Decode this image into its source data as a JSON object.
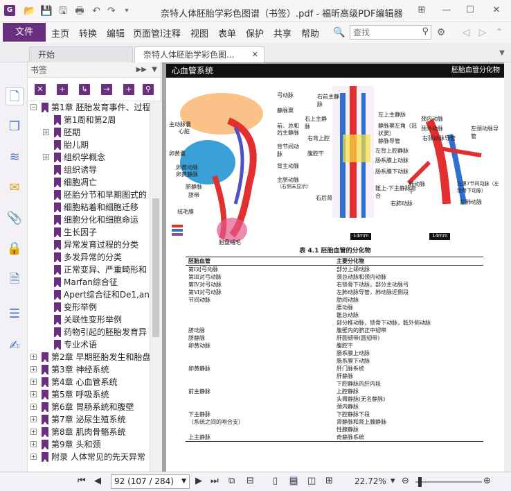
{
  "window": {
    "title": "奈特人体胚胎学彩色图谱（书签）.pdf - 福昕高级PDF编辑器",
    "app_icon": "G"
  },
  "menu": {
    "file": "文件",
    "items": [
      "主页",
      "转换",
      "编辑",
      "页面管理",
      "注释",
      "视图",
      "表单",
      "保护",
      "共享",
      "帮助"
    ],
    "search_placeholder": "查找"
  },
  "tabs": [
    {
      "label": "开始"
    },
    {
      "label": "奈特人体胚胎学彩色图..."
    }
  ],
  "bookmark_panel": {
    "title": "书签",
    "items": [
      {
        "label": "第1章 胚胎发育事件、过程",
        "level": 0,
        "exp": "−"
      },
      {
        "label": "第1周和第2周",
        "level": 1,
        "exp": ""
      },
      {
        "label": "胚期",
        "level": 1,
        "exp": "+"
      },
      {
        "label": "胎儿期",
        "level": 1,
        "exp": ""
      },
      {
        "label": "组织学概念",
        "level": 1,
        "exp": "+"
      },
      {
        "label": "组织诱导",
        "level": 1,
        "exp": ""
      },
      {
        "label": "细胞凋亡",
        "level": 1,
        "exp": ""
      },
      {
        "label": "胚胎分节和早期图式的",
        "level": 1,
        "exp": ""
      },
      {
        "label": "细胞粘着和细胞迁移",
        "level": 1,
        "exp": ""
      },
      {
        "label": "细胞分化和细胞命运",
        "level": 1,
        "exp": ""
      },
      {
        "label": "生长因子",
        "level": 1,
        "exp": ""
      },
      {
        "label": "异常发育过程的分类",
        "level": 1,
        "exp": ""
      },
      {
        "label": "多发异常的分类",
        "level": 1,
        "exp": ""
      },
      {
        "label": "正常变异、严重畸形和",
        "level": 1,
        "exp": ""
      },
      {
        "label": "Marfan综合征",
        "level": 1,
        "exp": ""
      },
      {
        "label": "Apert综合征和De1,an",
        "level": 1,
        "exp": ""
      },
      {
        "label": "变形举例",
        "level": 1,
        "exp": ""
      },
      {
        "label": "关联性变形举例",
        "level": 1,
        "exp": ""
      },
      {
        "label": "药物引起的胚胎发育异",
        "level": 1,
        "exp": ""
      },
      {
        "label": "专业术语",
        "level": 1,
        "exp": ""
      },
      {
        "label": "第2章 早期胚胎发生和胎盘",
        "level": 0,
        "exp": "+"
      },
      {
        "label": "第3章 神经系统",
        "level": 0,
        "exp": "+"
      },
      {
        "label": "第4章 心血管系统",
        "level": 0,
        "exp": "+"
      },
      {
        "label": "第5章 呼吸系统",
        "level": 0,
        "exp": "+"
      },
      {
        "label": "第6章 胃肠系统和腹壁",
        "level": 0,
        "exp": "+"
      },
      {
        "label": "第7章 泌尿生殖系统",
        "level": 0,
        "exp": "+"
      },
      {
        "label": "第8章 肌肉骨骼系统",
        "level": 0,
        "exp": "+"
      },
      {
        "label": "第9章 头和颈",
        "level": 0,
        "exp": "+"
      },
      {
        "label": "附录 人体常见的先天异常",
        "level": 0,
        "exp": "+"
      }
    ]
  },
  "document": {
    "header_left": "心血管系统",
    "header_right": "胚胎血管分化物",
    "fig_labels": {
      "a1": "弓动脉",
      "a2": "静脉窦",
      "a3": "前、总和",
      "a4": "后主静脉",
      "a5": "主动脉囊",
      "a6": "心脏",
      "a7": "卵黄囊",
      "a8": "卵黄动脉",
      "a9": "卵黄静脉",
      "a10": "背节间动脉",
      "a11": "背主动脉",
      "a12": "主脐动脉",
      "a13": "（右侧未显示）",
      "a14": "脐静脉",
      "a15": "脐带",
      "a16": "绒毛膜",
      "a17": "胎盘绒毛",
      "b1": "右前主静脉",
      "b2": "右上主静脉",
      "b3": "右背上腔",
      "b4": "腹腔干",
      "b5": "右后肾",
      "b6": "左上主静脉",
      "b7": "静脉窦左角（冠状窦）",
      "b8": "静脉导管",
      "b9": "左背上腔静脉",
      "b10": "肠系膜上动脉",
      "b11": "肠系膜下动脉",
      "b12": "骶上-下主静脉吻合",
      "c1": "颈内动脉",
      "c2": "颈外动脉",
      "c3": "右颈动脉导管",
      "c4": "左颈动脉导管",
      "c5": "肺动脉干",
      "c6": "右肺动脉",
      "c7": "左第7节间动脉（左锁骨下动脉）",
      "c8": "左肺动脉",
      "size1": "14mm",
      "size2": "14mm"
    },
    "table_title": "表 4.1   胚胎血管的分化物",
    "table_head": [
      "胚胎血管",
      "主要分化物"
    ],
    "table_rows": [
      [
        "第Ⅰ对弓动脉",
        "部分上颌动脉"
      ],
      [
        "第Ⅲ对弓动脉",
        "颈总动脉和颈内动脉"
      ],
      [
        "第Ⅳ对弓动脉",
        "右锁骨下动脉，部分主动脉弓"
      ],
      [
        "第Ⅵ对弓动脉",
        "左肺动脉导管，肺动脉近侧段"
      ],
      [
        "节间动脉",
        "肋间动脉"
      ],
      [
        "",
        "腰动脉"
      ],
      [
        "",
        "骶总动脉"
      ],
      [
        "",
        "部分椎动脉，锁骨下动脉，骶外侧动脉"
      ],
      [
        "脐动脉",
        "腹壁内的脐正中韧带"
      ],
      [
        "脐静脉",
        "肝圆韧带(圆韧带)"
      ],
      [
        "卵黄动脉",
        "腹腔干"
      ],
      [
        "",
        "肠系膜上动脉"
      ],
      [
        "",
        "肠系膜下动脉"
      ],
      [
        "卵黄静脉",
        "肝门脉系统"
      ],
      [
        "",
        "肝静脉"
      ],
      [
        "",
        "下腔静脉的肝内段"
      ],
      [
        "前主静脉",
        "上腔静脉"
      ],
      [
        "",
        "头臂静脉(无名静脉)"
      ],
      [
        "",
        "颈内静脉"
      ],
      [
        "下主静脉",
        "下腔静脉下段"
      ],
      [
        "（系统之间的吻合支）",
        "肾静脉和肾上腺静脉"
      ],
      [
        "",
        "性腺静脉"
      ],
      [
        "上主静脉",
        "奇静脉系统"
      ]
    ]
  },
  "status": {
    "page": "92 (107 / 284)",
    "zoom": "22.72%"
  }
}
